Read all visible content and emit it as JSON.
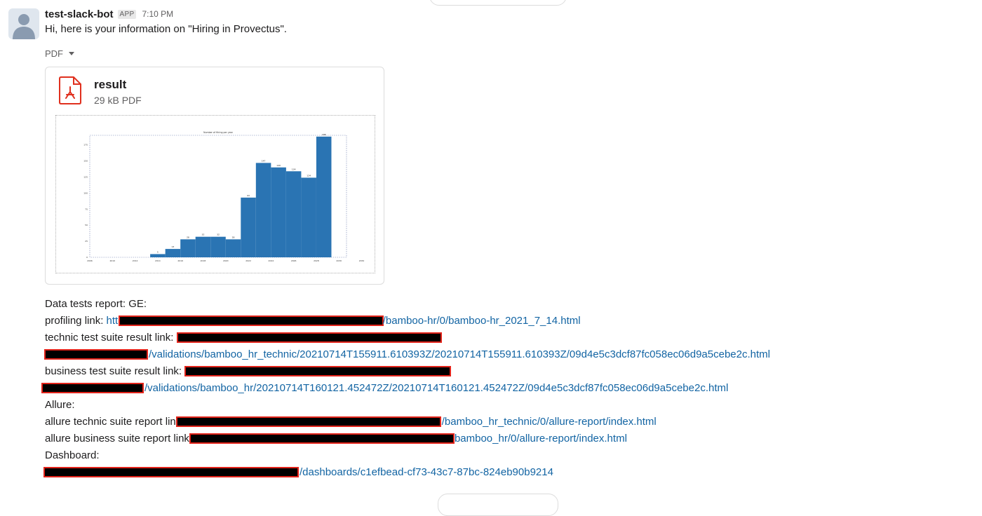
{
  "message": {
    "sender": "test-slack-bot",
    "badge": "APP",
    "time": "7:10 PM",
    "intro": "Hi, here is your information on \"Hiring in Provectus\"."
  },
  "file": {
    "type_label": "PDF",
    "name": "result",
    "meta": "29 kB PDF"
  },
  "icons": {
    "avatar": "user-avatar-icon",
    "file": "pdf-file-icon",
    "dropdown": "caret-down-icon"
  },
  "colors": {
    "bar": "#2a74b3",
    "link": "#1264a3",
    "pdf_icon": "#e0301e",
    "redaction_border": "#e2231a"
  },
  "chart_data": {
    "type": "bar",
    "title": "Number of Hiring per year",
    "x": [
      2010,
      2011,
      2012,
      2013,
      2014,
      2015,
      2016,
      2017,
      2018,
      2019,
      2020,
      2021
    ],
    "values": [
      5,
      13,
      28,
      32,
      32,
      28,
      93,
      147,
      140,
      134,
      124,
      188
    ],
    "xlim": [
      2006,
      2023
    ],
    "ylim": [
      0,
      190
    ],
    "x_ticks": [
      "2006",
      "2010",
      "2012",
      "2014",
      "2016",
      "2018",
      "2020",
      "2022",
      "2024",
      "2026",
      "2028",
      "2030",
      "2032"
    ],
    "y_ticks": [
      0,
      25,
      50,
      75,
      100,
      125,
      150,
      175
    ],
    "grid": false
  },
  "report": {
    "data_tests_heading": "Data tests report: GE:",
    "profiling_label": "profiling link:",
    "profiling_link_prefix": "http:",
    "profiling_link_suffix": "/bamboo-hr/0/bamboo-hr_2021_7_14.html",
    "technic_label": "technic test suite result link:",
    "technic_link_suffix": "/validations/bamboo_hr_technic/20210714T155911.610393Z/20210714T155911.610393Z/09d4e5c3dcf87fc058ec06d9a5cebe2c.html",
    "business_label": "business test suite result link:",
    "business_link_suffix": "/validations/bamboo_hr/20210714T160121.452472Z/20210714T160121.452472Z/09d4e5c3dcf87fc058ec06d9a5cebe2c.html",
    "allure_heading": "Allure:",
    "allure_technic_label": "allure technic suite report lin",
    "allure_technic_link_suffix": "/bamboo_hr_technic/0/allure-report/index.html",
    "allure_business_label": "allure business suite report link",
    "allure_business_link_suffix": "bamboo_hr/0/allure-report/index.html",
    "dashboard_heading": "Dashboard:",
    "dashboard_link_suffix": "/dashboards/c1efbead-cf73-43c7-87bc-824eb90b9214"
  }
}
